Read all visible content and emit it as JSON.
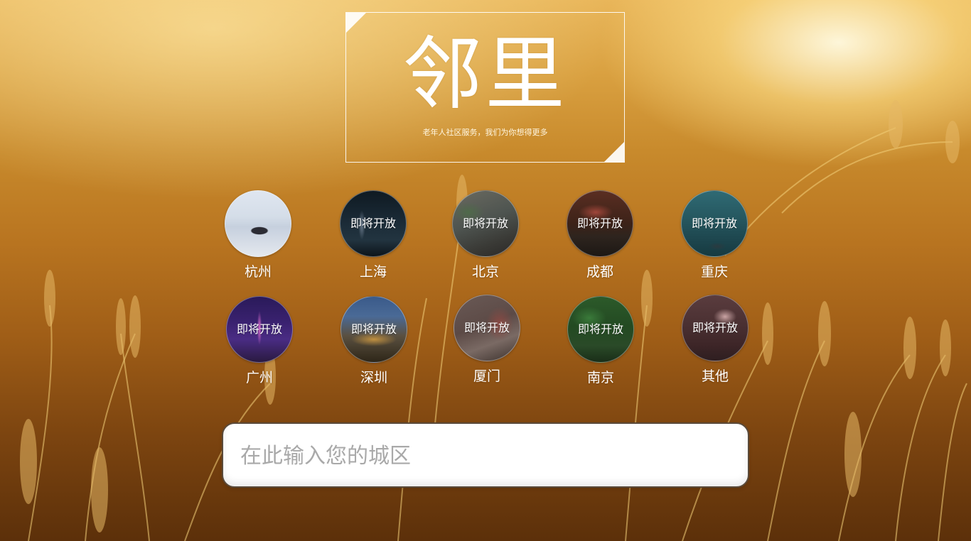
{
  "logo": {
    "title": "邻里",
    "subtitle": "老年人社区服务，我们为你想得更多"
  },
  "cities": [
    {
      "name": "杭州",
      "overlay": "",
      "thumb": "lake-boat"
    },
    {
      "name": "上海",
      "overlay": "即将开放",
      "thumb": "skyline-night"
    },
    {
      "name": "北京",
      "overlay": "即将开放",
      "thumb": "hutong"
    },
    {
      "name": "成都",
      "overlay": "即将开放",
      "thumb": "hotpot-table"
    },
    {
      "name": "重庆",
      "overlay": "即将开放",
      "thumb": "river-boat"
    },
    {
      "name": "广州",
      "overlay": "即将开放",
      "thumb": "canton-tower"
    },
    {
      "name": "深圳",
      "overlay": "即将开放",
      "thumb": "city-aerial"
    },
    {
      "name": "厦门",
      "overlay": "即将开放",
      "thumb": "old-street"
    },
    {
      "name": "南京",
      "overlay": "即将开放",
      "thumb": "tree-lined-road"
    },
    {
      "name": "其他",
      "overlay": "即将开放",
      "thumb": "blossom"
    }
  ],
  "search": {
    "placeholder": "在此输入您的城区",
    "value": ""
  },
  "colors": {
    "background": "#c88a2c",
    "text": "#ffffff",
    "placeholder": "#a9a9a9"
  }
}
